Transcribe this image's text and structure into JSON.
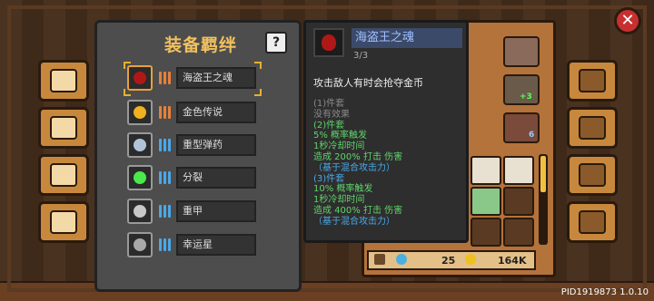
{
  "bonds_panel": {
    "title": "装备羁绊",
    "help_label": "?",
    "items": [
      {
        "name": "海盗王之魂",
        "icon": "flame-drop-icon",
        "icon_color": "#b01818",
        "tier_color": "#e8803a",
        "selected": true
      },
      {
        "name": "金色传说",
        "icon": "golden-flame-icon",
        "icon_color": "#f0b020",
        "tier_color": "#e8803a",
        "selected": false
      },
      {
        "name": "重型弹药",
        "icon": "ammo-box-icon",
        "icon_color": "#b0c4d8",
        "tier_color": "#4aa8e8",
        "selected": false
      },
      {
        "name": "分裂",
        "icon": "split-arrows-icon",
        "icon_color": "#4ae84a",
        "tier_color": "#4aa8e8",
        "selected": false
      },
      {
        "name": "重甲",
        "icon": "armor-icon",
        "icon_color": "#c8c8c8",
        "tier_color": "#4aa8e8",
        "selected": false
      },
      {
        "name": "幸运星",
        "icon": "lucky-star-icon",
        "icon_color": "#a8a8a8",
        "tier_color": "#4aa8e8",
        "selected": false
      }
    ]
  },
  "detail": {
    "name": "海盗王之魂",
    "count": "3/3",
    "description": "攻击敌人有时会抢夺金币",
    "lines": [
      {
        "text": "(1)件套",
        "color": "#8a8a8a"
      },
      {
        "text": "没有效果",
        "color": "#8a8a8a"
      },
      {
        "text": "(2)件套",
        "color": "#5fd46a"
      },
      {
        "text": "5% 概率触发",
        "color": "#5fd46a"
      },
      {
        "text": "1秒冷却时间",
        "color": "#5fd46a"
      },
      {
        "text": "造成 200% 打击 伤害",
        "color": "#5fd46a"
      },
      {
        "text": "（基于混合攻击力）",
        "color": "#4aa8e8"
      },
      {
        "text": "(3)件套",
        "color": "#4aa8e8"
      },
      {
        "text": "10% 概率触发",
        "color": "#5fd46a"
      },
      {
        "text": "1秒冷却时间",
        "color": "#5fd46a"
      },
      {
        "text": "造成 400% 打击 伤害",
        "color": "#5fd46a"
      },
      {
        "text": "（基于混合攻击力）",
        "color": "#4aa8e8"
      }
    ]
  },
  "inventory": {
    "gem_count": "25",
    "gold_count": "164K",
    "badge_count": "6",
    "buff_label": "+3"
  },
  "close_label": "✕",
  "version": "PID1919873 1.0.10",
  "colors": {
    "accent": "#f0c060",
    "panel": "#4d4d4d",
    "wood": "#c7883d"
  }
}
